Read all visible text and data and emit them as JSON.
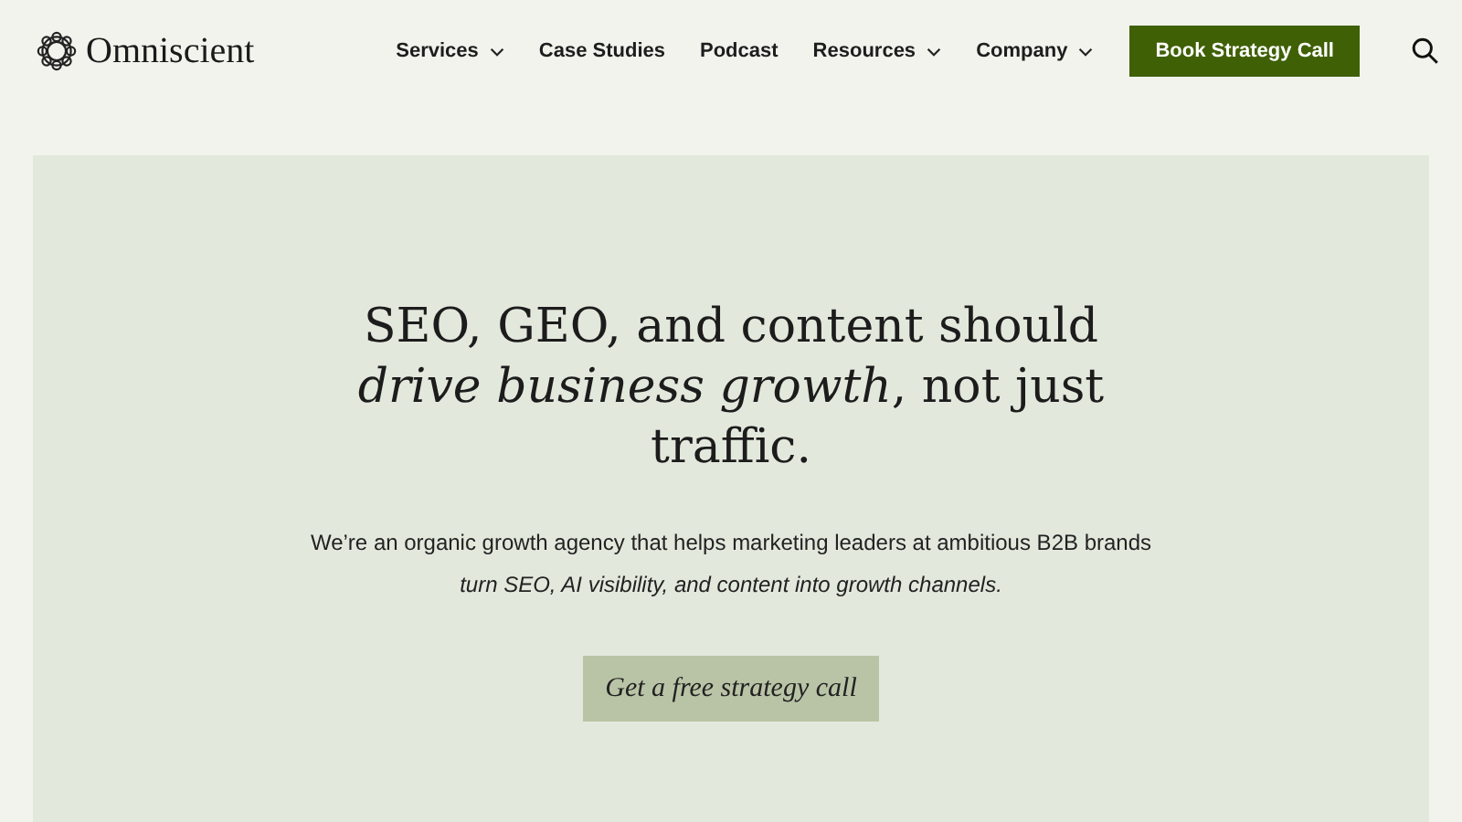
{
  "brand": {
    "name": "Omniscient"
  },
  "nav": [
    {
      "label": "Services",
      "dropdown": true
    },
    {
      "label": "Case Studies",
      "dropdown": false
    },
    {
      "label": "Podcast",
      "dropdown": false
    },
    {
      "label": "Resources",
      "dropdown": true
    },
    {
      "label": "Company",
      "dropdown": true
    }
  ],
  "cta": {
    "label": "Book Strategy Call"
  },
  "hero": {
    "headline_lines": [
      "SEO, GEO, and content should",
      "*drive business growth*, not just",
      "traffic."
    ],
    "subtitle_lines": [
      "We’re an organic growth agency that helps marketing leaders at ambitious B2B brands",
      "*turn SEO, AI visibility, and content into growth channels.*"
    ],
    "button": {
      "label": "Get a free strategy call"
    }
  }
}
